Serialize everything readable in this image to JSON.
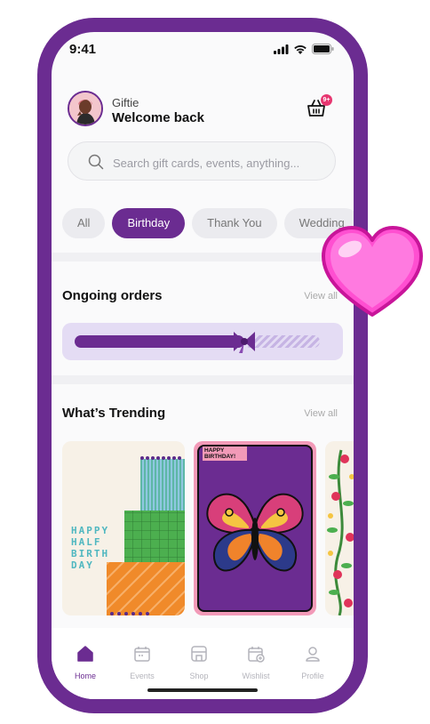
{
  "status": {
    "time": "9:41"
  },
  "header": {
    "app_name": "Giftie",
    "welcome": "Welcome back",
    "cart_badge": "9+"
  },
  "search": {
    "placeholder": "Search gift cards, events, anything..."
  },
  "categories": [
    "All",
    "Birthday",
    "Thank You",
    "Wedding"
  ],
  "selected_category": "Birthday",
  "orders": {
    "title": "Ongoing orders",
    "view_all": "View all",
    "progress": 0.66
  },
  "trending": {
    "title": "What’s Trending",
    "view_all": "View all",
    "cards": [
      {
        "text": "HAPPY HALF BIRTH DAY"
      },
      {
        "text": "HAPPY BIRTHDAY!"
      },
      {
        "text": ""
      }
    ]
  },
  "nav": [
    {
      "label": "Home",
      "icon": "home-icon",
      "active": true
    },
    {
      "label": "Events",
      "icon": "calendar-icon",
      "active": false
    },
    {
      "label": "Shop",
      "icon": "shop-icon",
      "active": false
    },
    {
      "label": "Wishlist",
      "icon": "wishlist-icon",
      "active": false
    },
    {
      "label": "Profile",
      "icon": "profile-icon",
      "active": false
    }
  ],
  "colors": {
    "brand": "#6b2c91",
    "badge": "#e73670",
    "heart": "#ff4fd1"
  }
}
